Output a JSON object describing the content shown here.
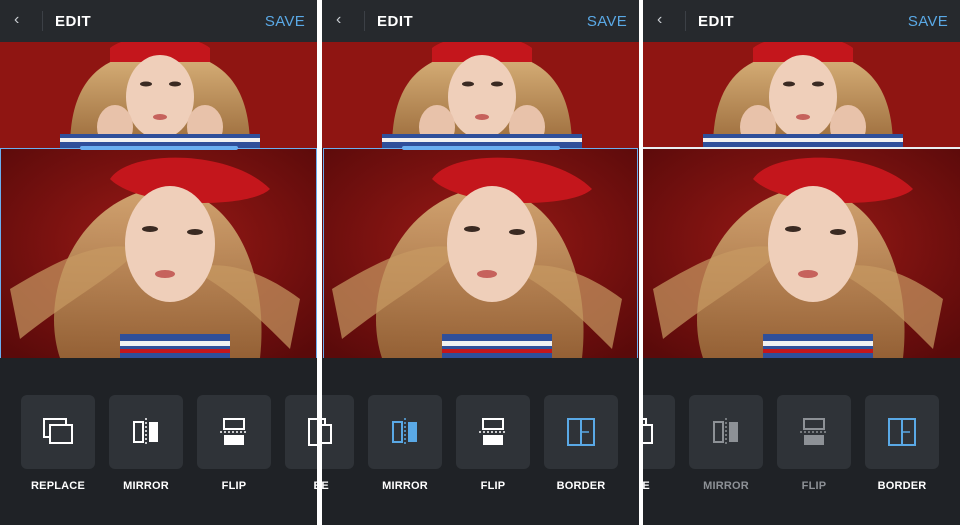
{
  "header": {
    "back_icon": "chevron-left-icon",
    "title": "EDIT",
    "save_label": "SAVE"
  },
  "colors": {
    "accent": "#5aa9e6",
    "background": "#1f2226",
    "tile": "#2f3338",
    "selection": "#6aaef0"
  },
  "panels": [
    {
      "tools": [
        {
          "label": "REPLACE",
          "icon": "replace-icon"
        },
        {
          "label": "MIRROR",
          "icon": "mirror-icon"
        },
        {
          "label": "FLIP",
          "icon": "flip-icon"
        },
        {
          "label": "BO",
          "icon": "border-icon"
        }
      ]
    },
    {
      "tools": [
        {
          "label": "ACE",
          "icon": "replace-icon"
        },
        {
          "label": "MIRROR",
          "icon": "mirror-icon"
        },
        {
          "label": "FLIP",
          "icon": "flip-icon"
        },
        {
          "label": "BORDER",
          "icon": "border-icon"
        }
      ]
    },
    {
      "tools": [
        {
          "label": "ACE",
          "icon": "replace-icon"
        },
        {
          "label": "MIRROR",
          "icon": "mirror-icon"
        },
        {
          "label": "FLIP",
          "icon": "flip-icon"
        },
        {
          "label": "BORDER",
          "icon": "border-icon"
        }
      ]
    }
  ]
}
